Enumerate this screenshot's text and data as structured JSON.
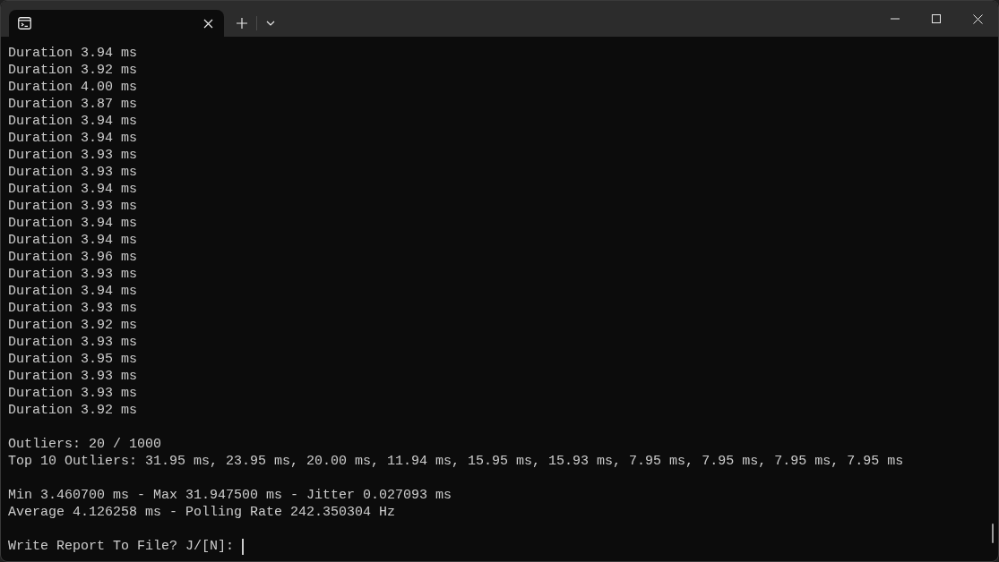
{
  "tabs": [
    {
      "selected": true
    }
  ],
  "output_blocks": [
    [
      "Duration 3.94 ms",
      "Duration 3.92 ms",
      "Duration 4.00 ms",
      "Duration 3.87 ms",
      "Duration 3.94 ms",
      "Duration 3.94 ms",
      "Duration 3.93 ms",
      "Duration 3.93 ms",
      "Duration 3.94 ms",
      "Duration 3.93 ms",
      "Duration 3.94 ms",
      "Duration 3.94 ms",
      "Duration 3.96 ms",
      "Duration 3.93 ms",
      "Duration 3.94 ms",
      "Duration 3.93 ms",
      "Duration 3.92 ms",
      "Duration 3.93 ms",
      "Duration 3.95 ms",
      "Duration 3.93 ms",
      "Duration 3.93 ms",
      "Duration 3.92 ms"
    ],
    [
      "Outliers: 20 / 1000",
      "Top 10 Outliers: 31.95 ms, 23.95 ms, 20.00 ms, 11.94 ms, 15.95 ms, 15.93 ms, 7.95 ms, 7.95 ms, 7.95 ms, 7.95 ms"
    ],
    [
      "Min 3.460700 ms - Max 31.947500 ms - Jitter 0.027093 ms",
      "Average 4.126258 ms - Polling Rate 242.350304 Hz"
    ]
  ],
  "prompt": {
    "text": "Write Report To File? J/[N]:",
    "cursor": true
  }
}
